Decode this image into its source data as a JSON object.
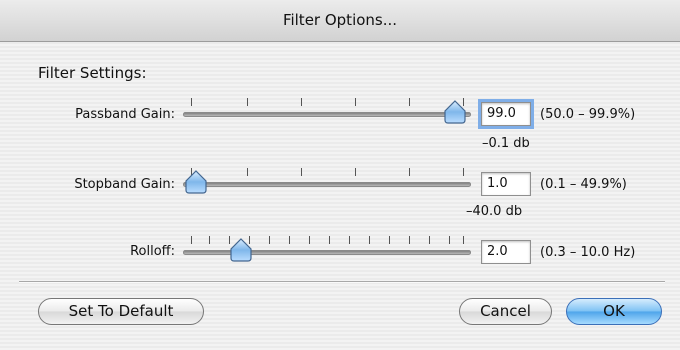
{
  "window": {
    "title": "Filter Options..."
  },
  "section_title": "Filter Settings:",
  "rows": [
    {
      "label": "Passband Gain:",
      "value": "99.0",
      "range": "(50.0 – 99.9%)",
      "db": "–0.1 db",
      "slider_level": 0.99
    },
    {
      "label": "Stopband Gain:",
      "value": "1.0",
      "range": "(0.1 – 49.9%)",
      "db": "–40.0 db",
      "slider_level": 0.0
    },
    {
      "label": "Rolloff:",
      "value": "2.0",
      "range": "(0.3 – 10.0 Hz)",
      "db": "",
      "slider_level": 0.17
    }
  ],
  "buttons": {
    "default": "Set To Default",
    "cancel": "Cancel",
    "ok": "OK"
  }
}
